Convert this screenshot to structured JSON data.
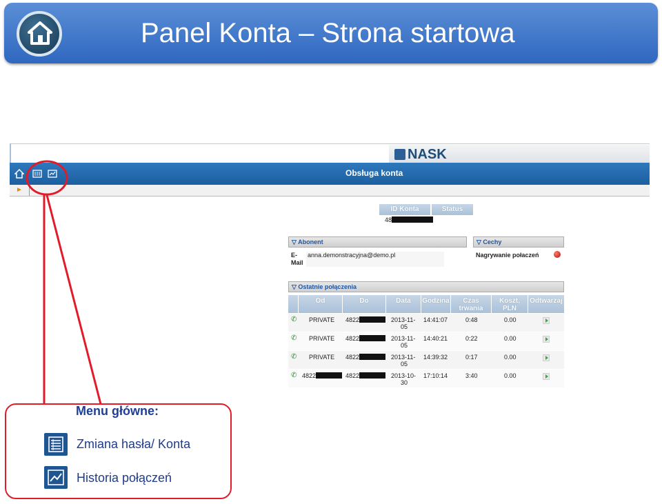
{
  "slide": {
    "title": "Panel Konta – Strona startowa",
    "menu_caption": "Menu główne:",
    "menu_items": [
      {
        "label": "Zmiana hasła/ Konta",
        "icon": "list-icon"
      },
      {
        "label": "Historia połączeń",
        "icon": "chart-line-icon"
      }
    ]
  },
  "app": {
    "brand": "NASK",
    "nav_title": "Obsługa konta",
    "account_table": {
      "headers": [
        "ID Konta",
        "Status"
      ],
      "id_prefix": "48",
      "status": ""
    },
    "abonent": {
      "title": "Abonent",
      "email_label_1": "E-",
      "email_label_2": "Mail",
      "email_value": "anna.demonstracyjna@demo.pl"
    },
    "cechy": {
      "title": "Cechy",
      "label": "Nagrywanie połaczeń"
    },
    "calls": {
      "title": "Ostatnie połączenia",
      "headers": [
        {
          "l1": "Od",
          "l2": ""
        },
        {
          "l1": "Do",
          "l2": ""
        },
        {
          "l1": "Data",
          "l2": ""
        },
        {
          "l1": "Godzina",
          "l2": ""
        },
        {
          "l1": "Czas",
          "l2": "trwania"
        },
        {
          "l1": "Koszt,",
          "l2": "PLN"
        },
        {
          "l1": "Odtwarzaj",
          "l2": ""
        }
      ],
      "rows": [
        {
          "from": "PRIVATE",
          "to_prefix": "4822",
          "date1": "2013-11-",
          "date2": "05",
          "time": "14:41:07",
          "duration": "0:48",
          "cost": "0.00"
        },
        {
          "from": "PRIVATE",
          "to_prefix": "4822",
          "date1": "2013-11-",
          "date2": "05",
          "time": "14:40:21",
          "duration": "0:22",
          "cost": "0.00"
        },
        {
          "from": "PRIVATE",
          "to_prefix": "4822",
          "date1": "2013-11-",
          "date2": "05",
          "time": "14:39:32",
          "duration": "0:17",
          "cost": "0.00"
        },
        {
          "from": "4822",
          "to_prefix": "4822",
          "date1": "2013-10-",
          "date2": "30",
          "time": "17:10:14",
          "duration": "3:40",
          "cost": "0.00"
        }
      ]
    }
  },
  "colors": {
    "banner": "#3a74c9",
    "navbar": "#2469ae",
    "annotation": "#e21b2a",
    "caption": "#1f3f94"
  }
}
